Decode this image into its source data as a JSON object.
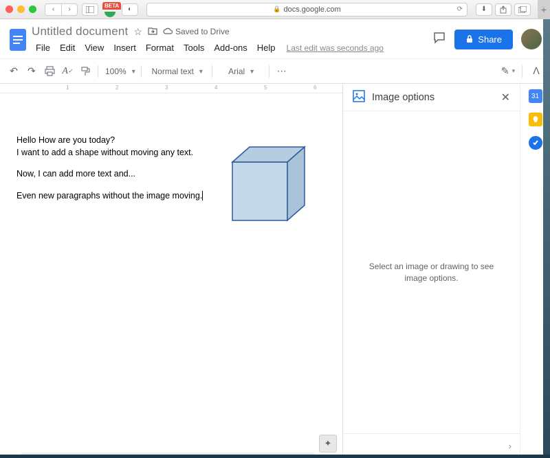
{
  "browser": {
    "url_host": "docs.google.com",
    "beta_label": "BETA"
  },
  "doc": {
    "title": "Untitled document",
    "saved_text": "Saved to Drive",
    "last_edit": "Last edit was seconds ago",
    "menus": [
      "File",
      "Edit",
      "View",
      "Insert",
      "Format",
      "Tools",
      "Add-ons",
      "Help"
    ]
  },
  "header": {
    "share_label": "Share"
  },
  "toolbar": {
    "zoom": "100%",
    "style": "Normal text",
    "font": "Arial"
  },
  "document_body": {
    "line1": "Hello How are you today?",
    "line2": "I want to add a shape without moving any text.",
    "line3": "Now, I can add more text and...",
    "line4": "Even new paragraphs without the image moving."
  },
  "side_panel": {
    "title": "Image options",
    "empty_message": "Select an image or drawing to see image options."
  },
  "ruler": {
    "n1": "1",
    "n2": "2",
    "n3": "3",
    "n4": "4",
    "n5": "5",
    "n6": "6"
  }
}
